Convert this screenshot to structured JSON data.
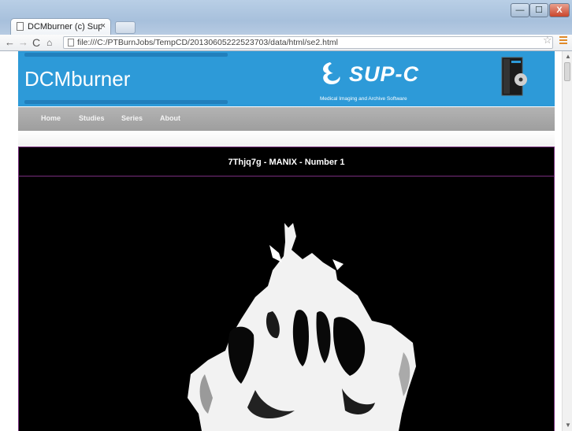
{
  "browser": {
    "tab_title": "DCMburner (c) Sup-(",
    "tab_close": "×",
    "url": "file:///C:/PTBurnJobs/TempCD/20130605222523703/data/html/se2.html",
    "window_buttons": {
      "minimize": "—",
      "maximize": "☐",
      "close": "X"
    },
    "nav": {
      "back": "←",
      "forward": "→",
      "reload": "C",
      "home": "⌂"
    },
    "star": "☆"
  },
  "site": {
    "brand": "DCMburner",
    "logo_text": "SUP-C",
    "tagline": "Medical Imaging and Archive Software",
    "nav": [
      "Home",
      "Studies",
      "Series",
      "About"
    ]
  },
  "series": {
    "title": "7Thjq7g - MANIX - Number 1"
  },
  "colors": {
    "header_blue": "#2d9ad8",
    "nav_gray": "#a9a9a9",
    "panel_border": "#7a2e7f"
  }
}
